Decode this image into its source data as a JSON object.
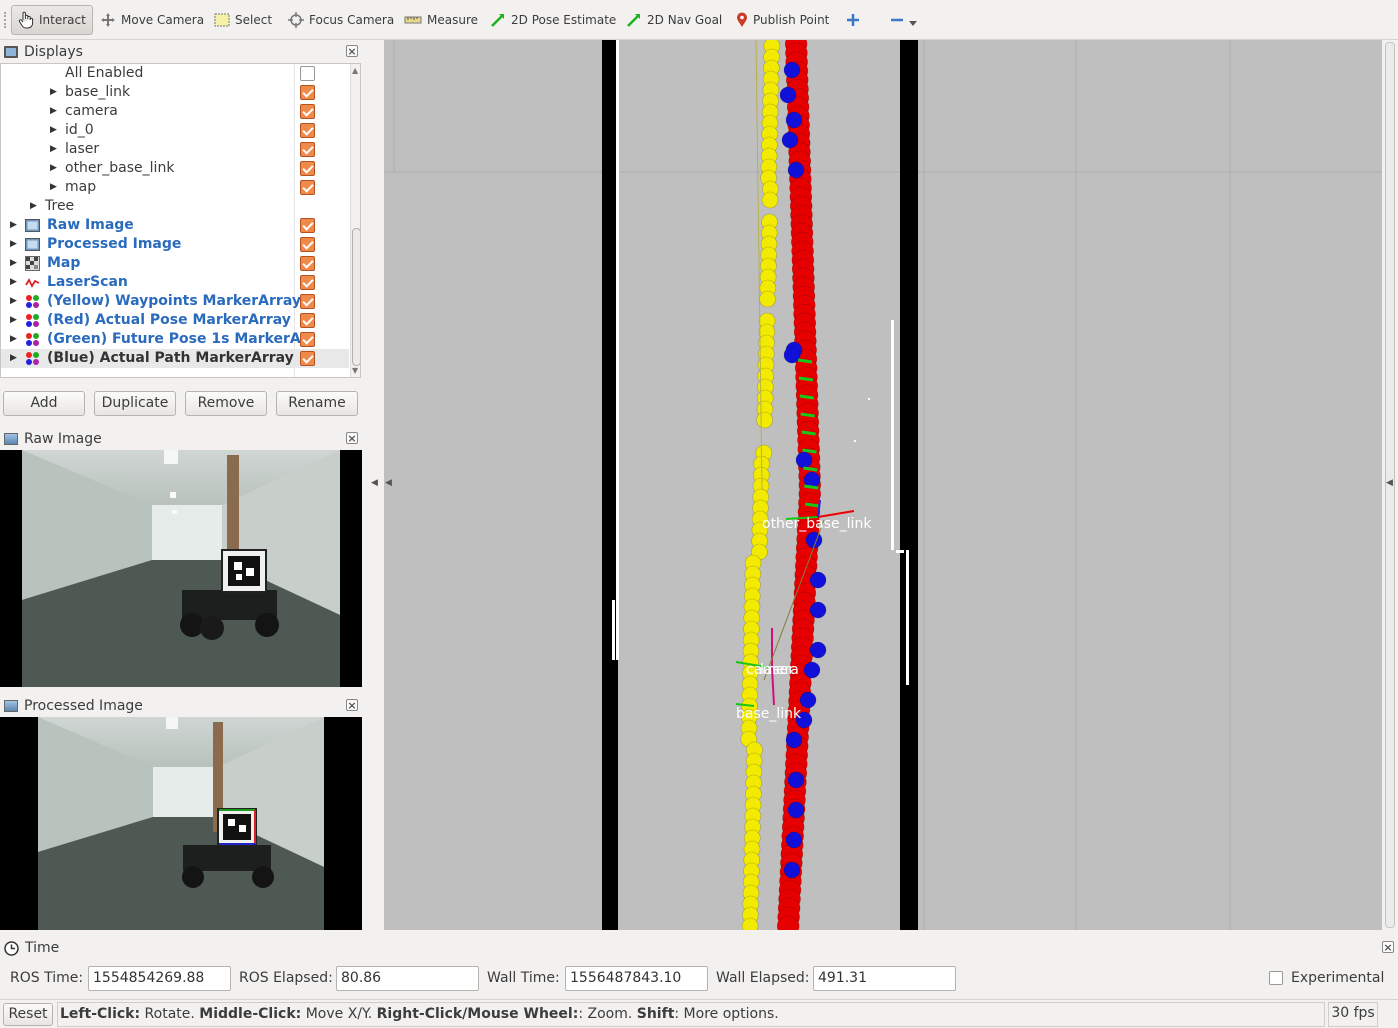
{
  "toolbar": {
    "tools": [
      {
        "label": "Interact",
        "icon": "hand-icon"
      },
      {
        "label": "Move Camera",
        "icon": "move-camera-icon"
      },
      {
        "label": "Select",
        "icon": "select-icon"
      },
      {
        "label": "Focus Camera",
        "icon": "focus-camera-icon"
      },
      {
        "label": "Measure",
        "icon": "ruler-icon"
      },
      {
        "label": "2D Pose Estimate",
        "icon": "green-arrow-icon"
      },
      {
        "label": "2D Nav Goal",
        "icon": "green-arrow-icon"
      },
      {
        "label": "Publish Point",
        "icon": "map-pin-icon"
      }
    ],
    "active_tool": "Interact"
  },
  "displays": {
    "title": "Displays",
    "items": [
      {
        "label": "All Enabled",
        "checked": false
      },
      {
        "label": "base_link",
        "checked": true
      },
      {
        "label": "camera",
        "checked": true
      },
      {
        "label": "id_0",
        "checked": true
      },
      {
        "label": "laser",
        "checked": true
      },
      {
        "label": "other_base_link",
        "checked": true
      },
      {
        "label": "map",
        "checked": true
      },
      {
        "label": "Tree"
      },
      {
        "label": "Raw Image",
        "checked": true,
        "icon": "image-icon"
      },
      {
        "label": "Processed Image",
        "checked": true,
        "icon": "image-icon"
      },
      {
        "label": "Map",
        "checked": true,
        "icon": "grid-map-icon"
      },
      {
        "label": "LaserScan",
        "checked": true,
        "icon": "laser-scan-icon"
      },
      {
        "label": "(Yellow) Waypoints MarkerArray",
        "checked": true,
        "icon": "marker-array-icon"
      },
      {
        "label": "(Red) Actual Pose MarkerArray",
        "checked": true,
        "icon": "marker-array-icon"
      },
      {
        "label": "(Green) Future Pose 1s MarkerA…",
        "checked": true,
        "icon": "marker-array-icon"
      },
      {
        "label": "(Blue) Actual Path MarkerArray",
        "checked": true,
        "icon": "marker-array-icon",
        "selected": true
      }
    ],
    "buttons": {
      "add": "Add",
      "duplicate": "Duplicate",
      "remove": "Remove",
      "rename": "Rename"
    }
  },
  "raw_image": {
    "title": "Raw Image"
  },
  "processed_image": {
    "title": "Processed Image"
  },
  "view3d": {
    "frame_labels": [
      "other_base_link",
      "camera",
      "laser",
      "base_link"
    ]
  },
  "time": {
    "title": "Time",
    "ros_time_label": "ROS Time:",
    "ros_time": "1554854269.88",
    "ros_elapsed_label": "ROS Elapsed:",
    "ros_elapsed": "80.86",
    "wall_time_label": "Wall Time:",
    "wall_time": "1556487843.10",
    "wall_elapsed_label": "Wall Elapsed:",
    "wall_elapsed": "491.31",
    "experimental_label": "Experimental",
    "experimental": false
  },
  "status": {
    "reset": "Reset",
    "hint": [
      {
        "b": "Left-Click:",
        "t": " Rotate. "
      },
      {
        "b": "Middle-Click:",
        "t": " Move X/Y. "
      },
      {
        "b": "Right-Click/Mouse Wheel:",
        "t": ": Zoom. "
      },
      {
        "b": "Shift",
        "t": ": More options."
      }
    ],
    "fps": "30 fps"
  },
  "colors": {
    "waypoints": "#f2ea00",
    "actual_pose": "#e60000",
    "actual_path": "#1010d8",
    "future_pose": "#18c818",
    "view_bg": "#bfbfbf",
    "checkbox": "#f08a4b",
    "display_label": "#2a6bbd"
  }
}
